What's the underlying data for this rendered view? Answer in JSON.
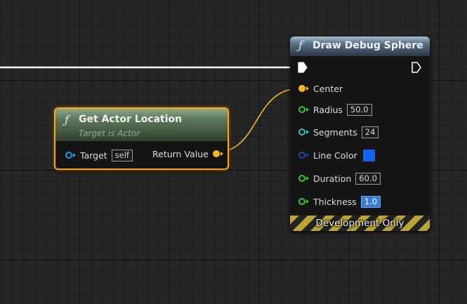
{
  "graph": {
    "get_actor_location": {
      "title": "Get Actor Location",
      "subtitle": "Target is Actor",
      "input_pin": {
        "label": "Target",
        "value": "self"
      },
      "output_pin": {
        "label": "Return Value"
      },
      "icon": "function-icon"
    },
    "draw_debug_sphere": {
      "title": "Draw Debug Sphere",
      "icon": "function-icon",
      "pins": {
        "center": {
          "label": "Center"
        },
        "radius": {
          "label": "Radius",
          "value": "50.0"
        },
        "segments": {
          "label": "Segments",
          "value": "24"
        },
        "line_color": {
          "label": "Line Color",
          "color": "#1462f5"
        },
        "duration": {
          "label": "Duration",
          "value": "60.0"
        },
        "thickness": {
          "label": "Thickness",
          "value": "1.0"
        }
      },
      "footer": "Development Only"
    },
    "function_glyph": "ƒ",
    "colors": {
      "vector_pin": "#f5b821",
      "float_pin": "#38c43f",
      "int_pin": "#2ec6b0",
      "color_pin": "#1d4ea6",
      "object_pin": "#1aa0e0",
      "exec_wire": "#ffffff",
      "vector_wire": "#f5b821",
      "selection": "#f4a623"
    }
  }
}
